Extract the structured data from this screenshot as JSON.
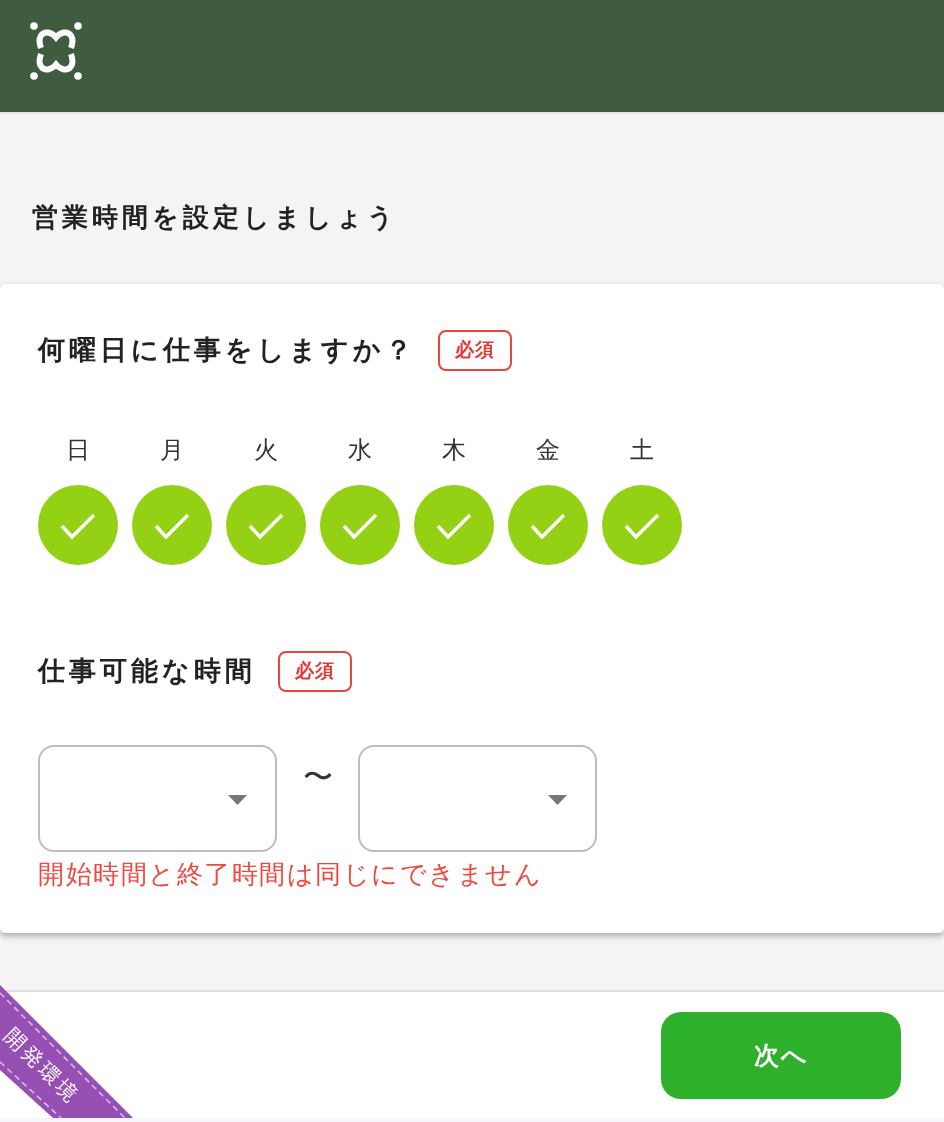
{
  "page_title": "営業時間を設定しましょう",
  "form": {
    "sections": [
      {
        "kind": "weekdays",
        "title": "何曜日に仕事をしますか？",
        "badge": "必須",
        "days": [
          {
            "label": "日",
            "checked": true
          },
          {
            "label": "月",
            "checked": true
          },
          {
            "label": "火",
            "checked": true
          },
          {
            "label": "水",
            "checked": true
          },
          {
            "label": "木",
            "checked": true
          },
          {
            "label": "金",
            "checked": true
          },
          {
            "label": "土",
            "checked": true
          }
        ]
      },
      {
        "kind": "time_range",
        "title": "仕事可能な時間",
        "badge": "必須",
        "separator": "〜",
        "error": "開始時間と終了時間は同じにできません"
      }
    ]
  },
  "footer": {
    "next_button": "次へ"
  },
  "ribbon": "開発環境"
}
